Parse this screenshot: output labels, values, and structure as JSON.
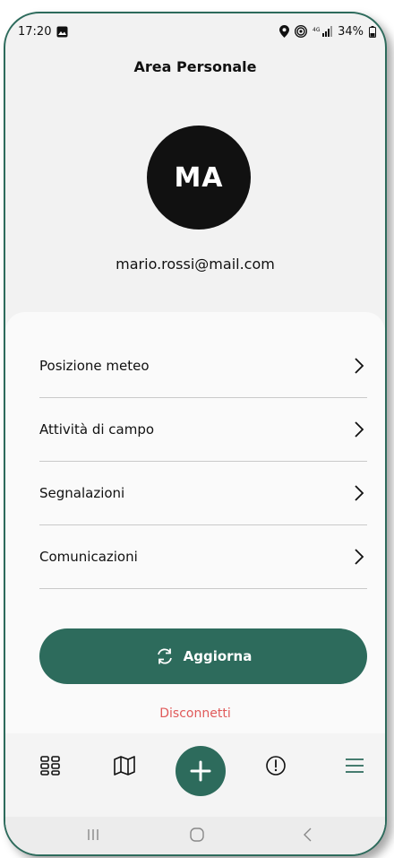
{
  "status_bar": {
    "time": "17:20",
    "battery": "34%"
  },
  "header": {
    "title": "Area Personale"
  },
  "profile": {
    "initials": "MA",
    "email": "mario.rossi@mail.com"
  },
  "menu": {
    "items": [
      {
        "label": "Posizione meteo"
      },
      {
        "label": "Attività di campo"
      },
      {
        "label": "Segnalazioni"
      },
      {
        "label": "Comunicazioni"
      }
    ]
  },
  "actions": {
    "update_label": "Aggiorna",
    "logout_label": "Disconnetti"
  },
  "tabbar": {
    "icons": [
      "dashboard-icon",
      "map-icon",
      "add-icon",
      "alert-icon",
      "menu-icon"
    ]
  },
  "colors": {
    "accent": "#2d6b5c",
    "danger": "#e05a5a"
  }
}
